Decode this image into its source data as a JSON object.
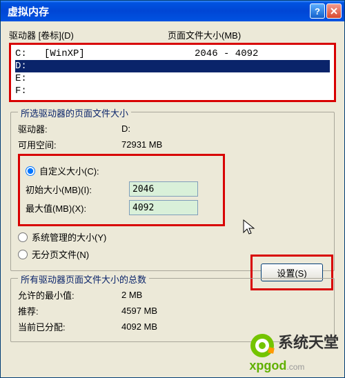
{
  "titlebar": {
    "title": "虚拟内存"
  },
  "headers": {
    "drive": "驱动器 [卷标](D)",
    "paging": "页面文件大小(MB)"
  },
  "drives": [
    {
      "label": "C:   [WinXP]",
      "size": "2046 - 4092",
      "selected": false
    },
    {
      "label": "D:",
      "size": "",
      "selected": true
    },
    {
      "label": "E:",
      "size": "",
      "selected": false
    },
    {
      "label": "F:",
      "size": "",
      "selected": false
    }
  ],
  "group1": {
    "title": "所选驱动器的页面文件大小",
    "drive_label": "驱动器:",
    "drive_value": "D:",
    "free_label": "可用空间:",
    "free_value": "72931 MB",
    "custom_label": "自定义大小(C):",
    "initial_label": "初始大小(MB)(I):",
    "initial_value": "2046",
    "max_label": "最大值(MB)(X):",
    "max_value": "4092",
    "system_label": "系统管理的大小(Y)",
    "none_label": "无分页文件(N)",
    "set_button": "设置(S)"
  },
  "group2": {
    "title": "所有驱动器页面文件大小的总数",
    "min_label": "允许的最小值:",
    "min_value": "2 MB",
    "rec_label": "推荐:",
    "rec_value": "4597 MB",
    "cur_label": "当前已分配:",
    "cur_value": "4092 MB"
  },
  "logo": {
    "text1": "系统天堂",
    "text2": "xpgod",
    "text3": ".com"
  }
}
